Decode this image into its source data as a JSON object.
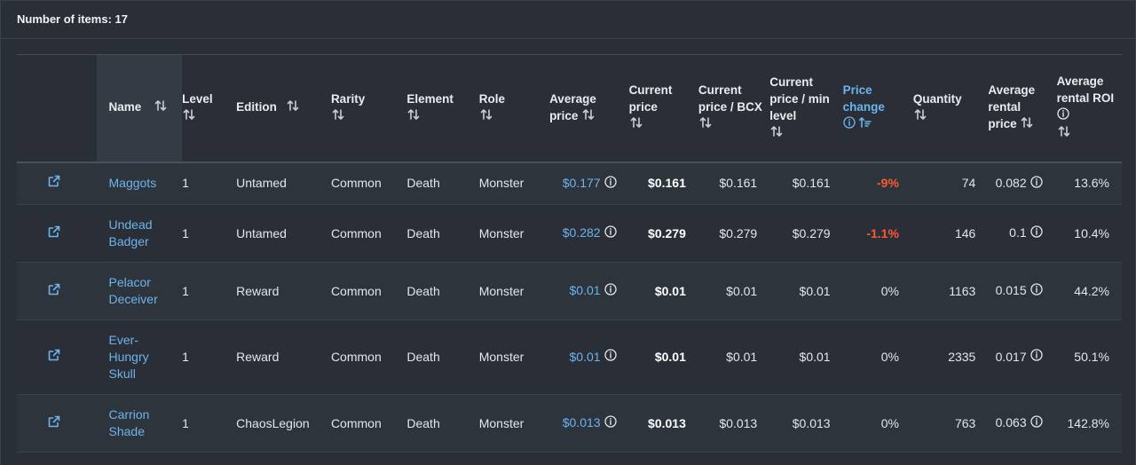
{
  "header": {
    "count_label": "Number of items: 17"
  },
  "columns": {
    "name": "Name",
    "level": "Level",
    "edition": "Edition",
    "rarity": "Rarity",
    "element": "Element",
    "role": "Role",
    "avg_price": "Average price",
    "current_price": "Current price",
    "price_bcx": "Current price / BCX",
    "price_min_level": "Current price / min level",
    "price_change": "Price change",
    "quantity": "Quantity",
    "avg_rental": "Average rental price",
    "rental_roi": "Average rental ROI"
  },
  "rows": [
    {
      "name": "Maggots",
      "level": "1",
      "edition": "Untamed",
      "rarity": "Common",
      "element": "Death",
      "role": "Monster",
      "avg_price": "$0.177",
      "current_price": "$0.161",
      "price_bcx": "$0.161",
      "price_min_level": "$0.161",
      "price_change": "-9%",
      "quantity": "74",
      "avg_rental": "0.082",
      "rental_roi": "13.6%"
    },
    {
      "name": "Undead Badger",
      "level": "1",
      "edition": "Untamed",
      "rarity": "Common",
      "element": "Death",
      "role": "Monster",
      "avg_price": "$0.282",
      "current_price": "$0.279",
      "price_bcx": "$0.279",
      "price_min_level": "$0.279",
      "price_change": "-1.1%",
      "quantity": "146",
      "avg_rental": "0.1",
      "rental_roi": "10.4%"
    },
    {
      "name": "Pelacor Deceiver",
      "level": "1",
      "edition": "Reward",
      "rarity": "Common",
      "element": "Death",
      "role": "Monster",
      "avg_price": "$0.01",
      "current_price": "$0.01",
      "price_bcx": "$0.01",
      "price_min_level": "$0.01",
      "price_change": "0%",
      "quantity": "1163",
      "avg_rental": "0.015",
      "rental_roi": "44.2%"
    },
    {
      "name": "Ever-Hungry Skull",
      "level": "1",
      "edition": "Reward",
      "rarity": "Common",
      "element": "Death",
      "role": "Monster",
      "avg_price": "$0.01",
      "current_price": "$0.01",
      "price_bcx": "$0.01",
      "price_min_level": "$0.01",
      "price_change": "0%",
      "quantity": "2335",
      "avg_rental": "0.017",
      "rental_roi": "50.1%"
    },
    {
      "name": "Carrion Shade",
      "level": "1",
      "edition": "ChaosLegion",
      "rarity": "Common",
      "element": "Death",
      "role": "Monster",
      "avg_price": "$0.013",
      "current_price": "$0.013",
      "price_bcx": "$0.013",
      "price_min_level": "$0.013",
      "price_change": "0%",
      "quantity": "763",
      "avg_rental": "0.063",
      "rental_roi": "142.8%"
    }
  ],
  "colors": {
    "accent": "#6db3ee",
    "negative": "#ff5733",
    "background": "#2a2f37"
  },
  "icons": {
    "sort": "sort-arrows-icon",
    "info": "info-circle-icon",
    "open": "external-link-icon"
  }
}
